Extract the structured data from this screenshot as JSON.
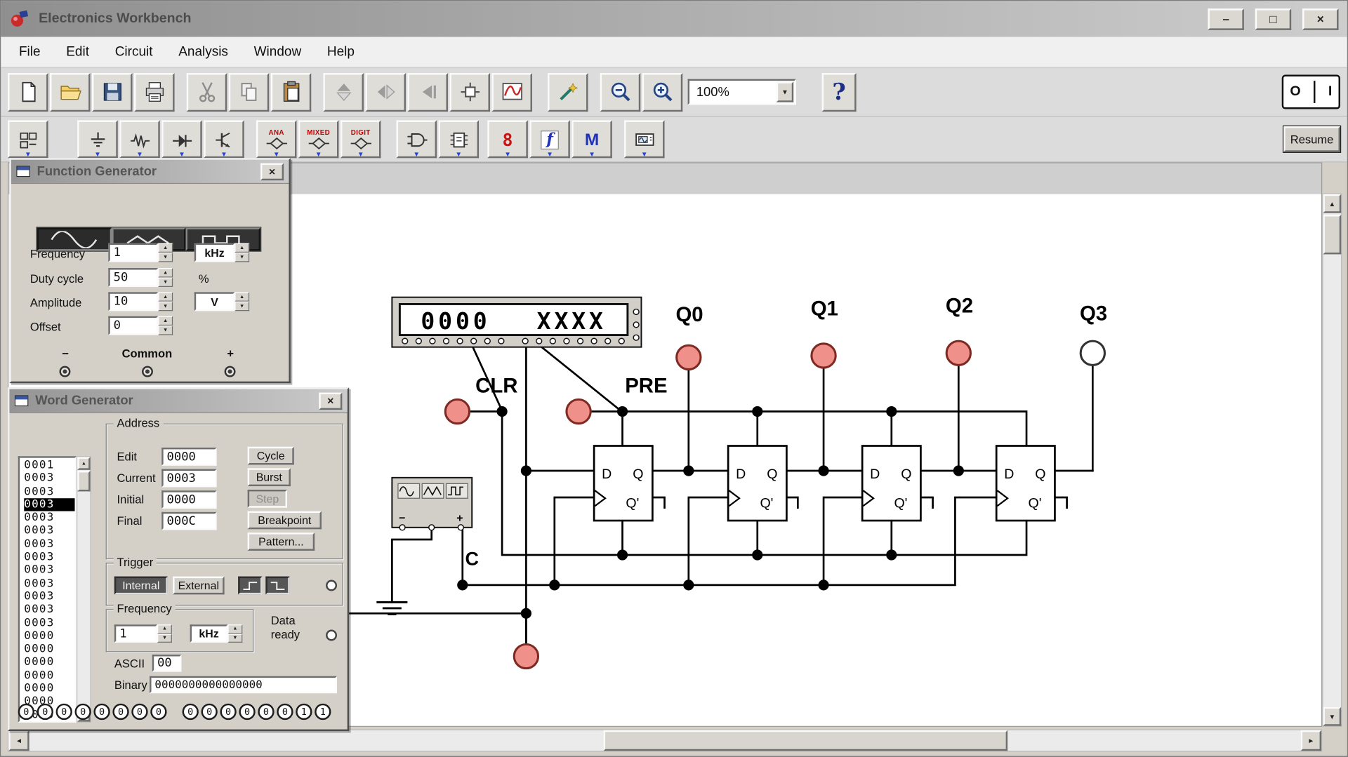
{
  "icons": {
    "spin_up": "▲",
    "spin_down": "▼",
    "scroll_up": "▲",
    "scroll_down": "▼",
    "scroll_left": "◄",
    "scroll_right": "►",
    "dropdown": "▼",
    "bin_dropdown": "▼"
  },
  "titlebar": {
    "title": "Electronics Workbench",
    "minimize_glyph": "–",
    "maximize_glyph": "□",
    "close_glyph": "×"
  },
  "menubar": {
    "items": [
      "File",
      "Edit",
      "Circuit",
      "Analysis",
      "Window",
      "Help"
    ]
  },
  "toolbar_main": {
    "zoom_value": "100%",
    "help_glyph": "?",
    "power_off_glyph": "O",
    "power_on_glyph": "I"
  },
  "toolbar_parts": {
    "ana_label": "ANA",
    "mixed_label": "MIXED",
    "digit_label": "DIGIT",
    "seven_seg_glyph": "8",
    "controls_glyph": "f",
    "misc_glyph": "M",
    "resume_label": "Resume"
  },
  "function_generator": {
    "title": "Function Generator",
    "close_glyph": "×",
    "frequency_label": "Frequency",
    "frequency_value": "1",
    "frequency_unit": "kHz",
    "duty_label": "Duty cycle",
    "duty_value": "50",
    "duty_unit": "%",
    "amplitude_label": "Amplitude",
    "amplitude_value": "10",
    "amplitude_unit": "V",
    "offset_label": "Offset",
    "offset_value": "0",
    "minus_label": "−",
    "common_label": "Common",
    "plus_label": "+"
  },
  "word_generator": {
    "title": "Word Generator",
    "close_glyph": "×",
    "address_rows": [
      "0001",
      "0003",
      "0003",
      "0003",
      "0003",
      "0003",
      "0003",
      "0003",
      "0003",
      "0003",
      "0003",
      "0003",
      "0003",
      "0000",
      "0000",
      "0000",
      "0000",
      "0000",
      "0000",
      "0000"
    ],
    "address_group_label": "Address",
    "edit_label": "Edit",
    "edit_value": "0000",
    "current_label": "Current",
    "current_value": "0003",
    "initial_label": "Initial",
    "initial_value": "0000",
    "final_label": "Final",
    "final_value": "000C",
    "cycle_label": "Cycle",
    "burst_label": "Burst",
    "step_label": "Step",
    "breakpoint_label": "Breakpoint",
    "pattern_label": "Pattern...",
    "trigger_group_label": "Trigger",
    "internal_label": "Internal",
    "external_label": "External",
    "frequency_group_label": "Frequency",
    "frequency_value": "1",
    "frequency_unit": "kHz",
    "data_ready_label": "Data ready",
    "ascii_label": "ASCII",
    "ascii_value": "00",
    "binary_label": "Binary",
    "binary_value": "0000000000000000",
    "output_bits": [
      "0",
      "0",
      "0",
      "0",
      "0",
      "0",
      "0",
      "0",
      "0",
      "0",
      "0",
      "0",
      "0",
      "0",
      "1",
      "1"
    ]
  },
  "circuit": {
    "display_left": "0000",
    "display_right": "XXXX",
    "q0_label": "Q0",
    "q1_label": "Q1",
    "q2_label": "Q2",
    "q3_label": "Q3",
    "clr_label": "CLR",
    "pre_label": "PRE",
    "clock_label": "C",
    "ff_d": "D",
    "ff_q": "Q",
    "ff_qn": "Q'",
    "probe_on_color": "#f0908a",
    "probe_off_color": "#ffffff"
  }
}
